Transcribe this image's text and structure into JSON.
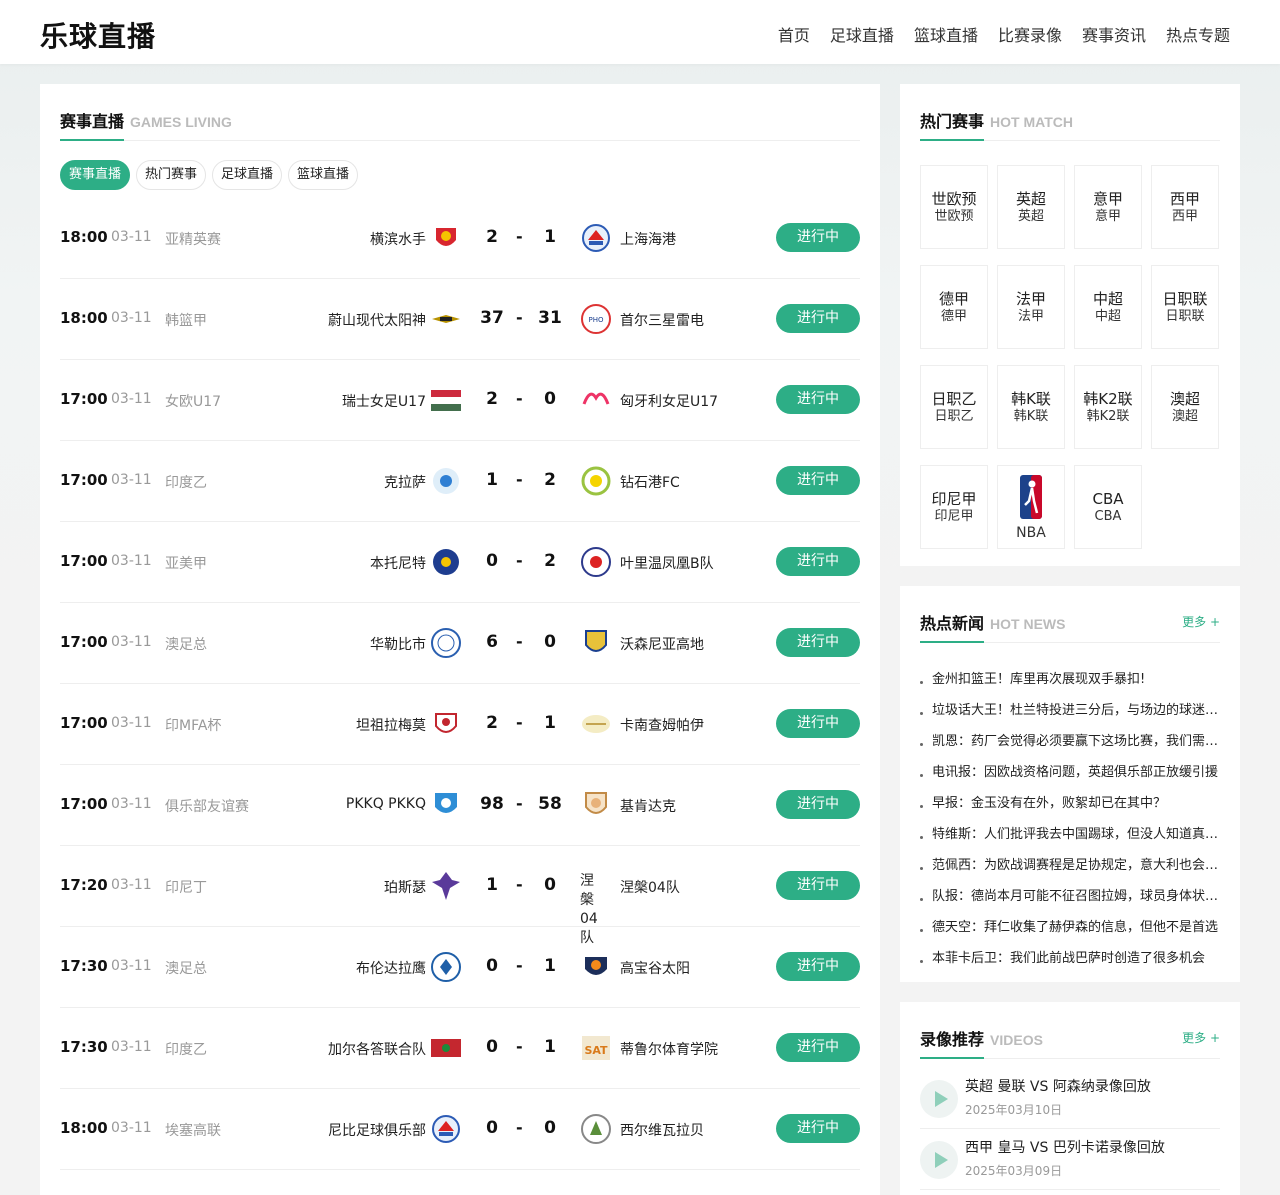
{
  "site": {
    "logo": "乐球直播"
  },
  "nav": [
    "首页",
    "足球直播",
    "篮球直播",
    "比赛录像",
    "赛事资讯",
    "热点专题"
  ],
  "live": {
    "title_cn": "赛事直播",
    "title_en": "GAMES LIVING",
    "tabs": [
      "赛事直播",
      "热门赛事",
      "足球直播",
      "篮球直播"
    ],
    "matches": [
      {
        "time": "18:00",
        "date": "03-11",
        "league": "亚精英赛",
        "home": "横滨水手",
        "home_score": "2",
        "sep": "-",
        "away_score": "1",
        "away": "上海海港",
        "status": "进行中"
      },
      {
        "time": "18:00",
        "date": "03-11",
        "league": "韩篮甲",
        "home": "蔚山现代太阳神",
        "home_score": "37",
        "sep": "-",
        "away_score": "31",
        "away": "首尔三星雷电",
        "status": "进行中"
      },
      {
        "time": "17:00",
        "date": "03-11",
        "league": "女欧U17",
        "home": "瑞士女足U17",
        "home_score": "2",
        "sep": "-",
        "away_score": "0",
        "away": "匈牙利女足U17",
        "status": "进行中"
      },
      {
        "time": "17:00",
        "date": "03-11",
        "league": "印度乙",
        "home": "克拉萨",
        "home_score": "1",
        "sep": "-",
        "away_score": "2",
        "away": "钻石港FC",
        "status": "进行中"
      },
      {
        "time": "17:00",
        "date": "03-11",
        "league": "亚美甲",
        "home": "本托尼特",
        "home_score": "0",
        "sep": "-",
        "away_score": "2",
        "away": "叶里温凤凰B队",
        "status": "进行中"
      },
      {
        "time": "17:00",
        "date": "03-11",
        "league": "澳足总",
        "home": "华勒比市",
        "home_score": "6",
        "sep": "-",
        "away_score": "0",
        "away": "沃森尼亚高地",
        "status": "进行中"
      },
      {
        "time": "17:00",
        "date": "03-11",
        "league": "印MFA杯",
        "home": "坦祖拉梅莫",
        "home_score": "2",
        "sep": "-",
        "away_score": "1",
        "away": "卡南查姆帕伊",
        "status": "进行中"
      },
      {
        "time": "17:00",
        "date": "03-11",
        "league": "俱乐部友谊赛",
        "home": "PKKQ PKKQ",
        "home_score": "98",
        "sep": "-",
        "away_score": "58",
        "away": "基肯达克",
        "status": "进行中"
      },
      {
        "time": "17:20",
        "date": "03-11",
        "league": "印尼丁",
        "home": "珀斯瑟",
        "home_score": "1",
        "sep": "-",
        "away_score": "0",
        "away": "涅槃04队",
        "away_logo_text": "涅槃04队",
        "status": "进行中"
      },
      {
        "time": "17:30",
        "date": "03-11",
        "league": "澳足总",
        "home": "布伦达拉鹰",
        "home_score": "0",
        "sep": "-",
        "away_score": "1",
        "away": "高宝谷太阳",
        "status": "进行中"
      },
      {
        "time": "17:30",
        "date": "03-11",
        "league": "印度乙",
        "home": "加尔各答联合队",
        "home_score": "0",
        "sep": "-",
        "away_score": "1",
        "away": "蒂鲁尔体育学院",
        "status": "进行中"
      },
      {
        "time": "18:00",
        "date": "03-11",
        "league": "埃塞高联",
        "home": "尼比足球俱乐部",
        "home_score": "0",
        "sep": "-",
        "away_score": "0",
        "away": "西尔维瓦拉贝",
        "status": "进行中"
      }
    ]
  },
  "hot_match": {
    "title_cn": "热门赛事",
    "title_en": "HOT MATCH",
    "items": [
      {
        "l1": "世欧预",
        "l2": "世欧预"
      },
      {
        "l1": "英超",
        "l2": "英超"
      },
      {
        "l1": "意甲",
        "l2": "意甲"
      },
      {
        "l1": "西甲",
        "l2": "西甲"
      },
      {
        "l1": "德甲",
        "l2": "德甲"
      },
      {
        "l1": "法甲",
        "l2": "法甲"
      },
      {
        "l1": "中超",
        "l2": "中超"
      },
      {
        "l1": "日职联",
        "l2": "日职联"
      },
      {
        "l1": "日职乙",
        "l2": "日职乙"
      },
      {
        "l1": "韩K联",
        "l2": "韩K联"
      },
      {
        "l1": "韩K2联",
        "l2": "韩K2联"
      },
      {
        "l1": "澳超",
        "l2": "澳超"
      },
      {
        "l1": "印尼甲",
        "l2": "印尼甲"
      },
      {
        "l1": "",
        "l2": "NBA",
        "logo": "nba-logo"
      },
      {
        "l1": "CBA",
        "l2": "CBA"
      }
    ]
  },
  "hot_news": {
    "title_cn": "热点新闻",
    "title_en": "HOT NEWS",
    "more": "更多 +",
    "items": [
      "金州扣篮王！库里再次展现双手暴扣!",
      "垃圾话大王！杜兰特投进三分后，与场边的球迷互动",
      "凯恩：药厂会觉得必须要赢下这场比赛，我们需要保持专注",
      "电讯报：因欧战资格问题，英超俱乐部正放缓引援",
      "早报：金玉没有在外，败絮却已在其中？",
      "特维斯：人们批评我去中国踢球，但没人知道真实情况",
      "范佩西：为欧战调赛程是足协规定，意大利也会这么做",
      "队报：德尚本月可能不征召图拉姆，球员身体状况不佳",
      "德天空：拜仁收集了赫伊森的信息，但他不是首选",
      "本菲卡后卫：我们此前战巴萨时创造了很多机会"
    ]
  },
  "videos": {
    "title_cn": "录像推荐",
    "title_en": "VIDEOS",
    "more": "更多 +",
    "items": [
      {
        "title": "英超 曼联 VS 阿森纳录像回放",
        "date": "2025年03月10日"
      },
      {
        "title": "西甲 皇马 VS 巴列卡诺录像回放",
        "date": "2025年03月09日"
      }
    ]
  },
  "colors": {
    "accent": "#2dae86",
    "muted": "#999999"
  }
}
